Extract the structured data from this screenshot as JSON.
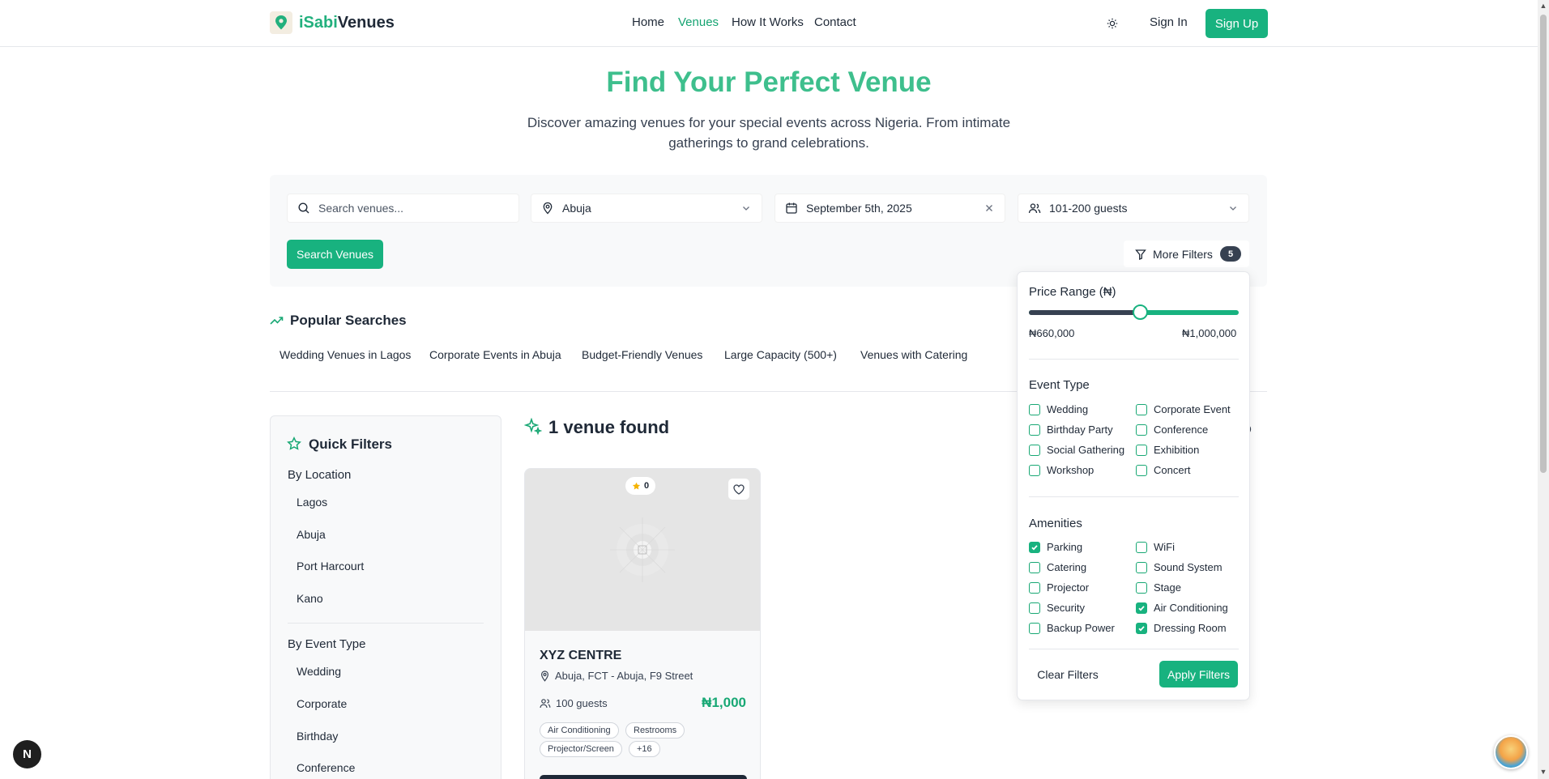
{
  "header": {
    "brand_prefix": "iSabi",
    "brand_suffix": "Venues",
    "nav": [
      {
        "label": "Home",
        "active": false
      },
      {
        "label": "Venues",
        "active": true
      },
      {
        "label": "How It Works",
        "active": false
      },
      {
        "label": "Contact",
        "active": false
      }
    ],
    "sign_in": "Sign In",
    "sign_up": "Sign Up"
  },
  "hero": {
    "title": "Find Your Perfect Venue",
    "subtitle": "Discover amazing venues for your special events across Nigeria. From intimate gatherings to grand celebrations."
  },
  "search": {
    "placeholder": "Search venues...",
    "location": "Abuja",
    "date": "September 5th, 2025",
    "guests": "101-200 guests",
    "search_button": "Search Venues",
    "more_filters": "More Filters",
    "filter_count": "5"
  },
  "popular": {
    "title": "Popular Searches",
    "tags": [
      "Wedding Venues in Lagos",
      "Corporate Events in Abuja",
      "Budget-Friendly Venues",
      "Large Capacity (500+)",
      "Venues with Catering"
    ]
  },
  "quick_filters": {
    "title": "Quick Filters",
    "by_location": "By Location",
    "locations": [
      "Lagos",
      "Abuja",
      "Port Harcourt",
      "Kano"
    ],
    "by_event_type": "By Event Type",
    "event_types": [
      "Wedding",
      "Corporate",
      "Birthday",
      "Conference"
    ]
  },
  "results": {
    "count_text": "1 venue found",
    "venue": {
      "name": "XYZ CENTRE",
      "rating": "0",
      "location": "Abuja, FCT - Abuja, F9 Street",
      "guests": "100 guests",
      "price": "₦1,000",
      "tags": [
        "Air Conditioning",
        "Restrooms",
        "Projector/Screen",
        "+16"
      ]
    }
  },
  "filters_panel": {
    "price_title": "Price Range (₦)",
    "price_min": "₦660,000",
    "price_max": "₦1,000,000",
    "slider_fraction": 0.53,
    "event_type_title": "Event Type",
    "event_types": [
      {
        "label": "Wedding",
        "checked": false
      },
      {
        "label": "Corporate Event",
        "checked": false
      },
      {
        "label": "Birthday Party",
        "checked": false
      },
      {
        "label": "Conference",
        "checked": false
      },
      {
        "label": "Social Gathering",
        "checked": false
      },
      {
        "label": "Exhibition",
        "checked": false
      },
      {
        "label": "Workshop",
        "checked": false
      },
      {
        "label": "Concert",
        "checked": false
      }
    ],
    "amenities_title": "Amenities",
    "amenities": [
      {
        "label": "Parking",
        "checked": true
      },
      {
        "label": "WiFi",
        "checked": false
      },
      {
        "label": "Catering",
        "checked": false
      },
      {
        "label": "Sound System",
        "checked": false
      },
      {
        "label": "Projector",
        "checked": false
      },
      {
        "label": "Stage",
        "checked": false
      },
      {
        "label": "Security",
        "checked": false
      },
      {
        "label": "Air Conditioning",
        "checked": true
      },
      {
        "label": "Backup Power",
        "checked": false
      },
      {
        "label": "Dressing Room",
        "checked": true
      }
    ],
    "clear": "Clear Filters",
    "apply": "Apply Filters"
  },
  "dev_badge": "N",
  "colors": {
    "accent": "#18b27f",
    "title": "#3ebf8d",
    "dark": "#1f2937"
  }
}
